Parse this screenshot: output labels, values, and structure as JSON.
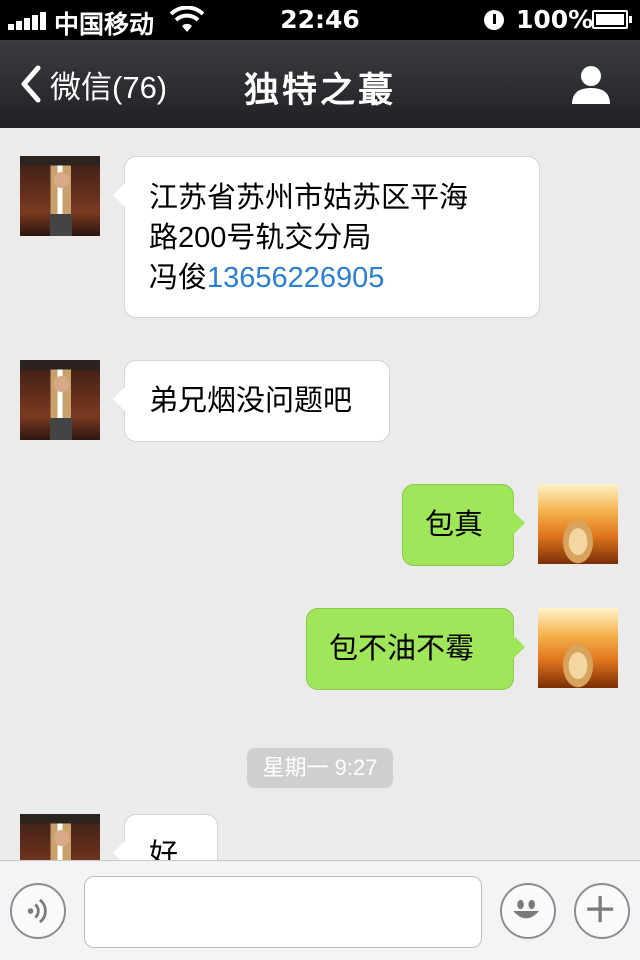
{
  "status_bar": {
    "carrier": "中国移动",
    "time": "22:46",
    "battery_percent": "100%",
    "battery_level": 1.0,
    "signal_bars": 5
  },
  "nav": {
    "back_label": "微信(76)",
    "title": "独特之蕞"
  },
  "messages": [
    {
      "sender": "contact",
      "lines": [
        "江苏省苏州市姑苏区平海",
        "路200号轨交分局"
      ],
      "line3_prefix": "冯俊",
      "phone": "13656226905"
    },
    {
      "sender": "contact",
      "text": "弟兄烟没问题吧"
    },
    {
      "sender": "me",
      "text": "包真"
    },
    {
      "sender": "me",
      "text": "包不油不霉"
    },
    {
      "sender": "contact",
      "text": "好"
    }
  ],
  "timestamp": "星期一 9:27",
  "input": {
    "value": "",
    "placeholder": ""
  },
  "colors": {
    "nav_bg": "#2b2d30",
    "chat_bg": "#ebebeb",
    "incoming_bubble": "#ffffff",
    "outgoing_bubble": "#a0e65a",
    "link": "#2a7fd4"
  }
}
